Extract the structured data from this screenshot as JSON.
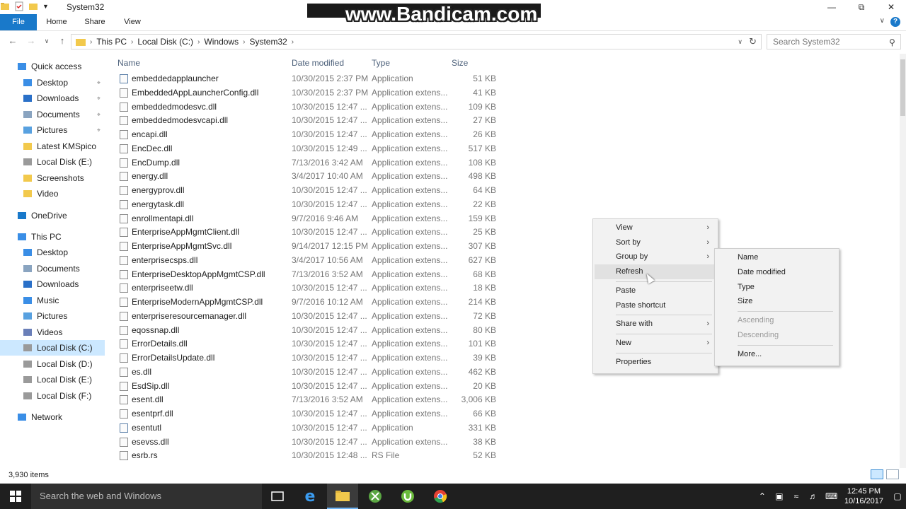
{
  "window": {
    "title": "System32",
    "watermark": "www.Bandicam.com"
  },
  "ribbon": {
    "tabs": [
      "File",
      "Home",
      "Share",
      "View"
    ]
  },
  "address": {
    "crumbs": [
      "This PC",
      "Local Disk (C:)",
      "Windows",
      "System32"
    ],
    "search_placeholder": "Search System32"
  },
  "sidebar": {
    "items": [
      {
        "label": "Quick access",
        "icon": "star-icon",
        "level": 0
      },
      {
        "label": "Desktop",
        "icon": "desktop-icon",
        "level": 1,
        "pinned": true
      },
      {
        "label": "Downloads",
        "icon": "download-icon",
        "level": 1,
        "pinned": true
      },
      {
        "label": "Documents",
        "icon": "documents-icon",
        "level": 1,
        "pinned": true
      },
      {
        "label": "Pictures",
        "icon": "pictures-icon",
        "level": 1,
        "pinned": true
      },
      {
        "label": "Latest KMSpico",
        "icon": "folder-icon",
        "level": 1
      },
      {
        "label": "Local Disk (E:)",
        "icon": "drive-icon",
        "level": 1
      },
      {
        "label": "Screenshots",
        "icon": "folder-icon",
        "level": 1
      },
      {
        "label": "Video",
        "icon": "folder-icon",
        "level": 1
      },
      {
        "label": "OneDrive",
        "icon": "cloud-icon",
        "level": 0
      },
      {
        "label": "This PC",
        "icon": "computer-icon",
        "level": 0
      },
      {
        "label": "Desktop",
        "icon": "desktop-icon",
        "level": 1
      },
      {
        "label": "Documents",
        "icon": "documents-icon",
        "level": 1
      },
      {
        "label": "Downloads",
        "icon": "download-icon",
        "level": 1
      },
      {
        "label": "Music",
        "icon": "music-icon",
        "level": 1
      },
      {
        "label": "Pictures",
        "icon": "pictures-icon",
        "level": 1
      },
      {
        "label": "Videos",
        "icon": "videos-icon",
        "level": 1
      },
      {
        "label": "Local Disk (C:)",
        "icon": "drive-icon",
        "level": 1,
        "selected": true
      },
      {
        "label": "Local Disk  (D:)",
        "icon": "drive-icon",
        "level": 1
      },
      {
        "label": "Local Disk (E:)",
        "icon": "drive-icon",
        "level": 1
      },
      {
        "label": "Local Disk (F:)",
        "icon": "drive-icon",
        "level": 1
      },
      {
        "label": "Network",
        "icon": "network-icon",
        "level": 0
      }
    ]
  },
  "columns": {
    "name": "Name",
    "date": "Date modified",
    "type": "Type",
    "size": "Size"
  },
  "files": [
    {
      "name": "embeddedapplauncher",
      "date": "10/30/2015 2:37 PM",
      "type": "Application",
      "size": "51 KB",
      "app": true
    },
    {
      "name": "EmbeddedAppLauncherConfig.dll",
      "date": "10/30/2015 2:37 PM",
      "type": "Application extens...",
      "size": "41 KB"
    },
    {
      "name": "embeddedmodesvc.dll",
      "date": "10/30/2015 12:47 ...",
      "type": "Application extens...",
      "size": "109 KB"
    },
    {
      "name": "embeddedmodesvcapi.dll",
      "date": "10/30/2015 12:47 ...",
      "type": "Application extens...",
      "size": "27 KB"
    },
    {
      "name": "encapi.dll",
      "date": "10/30/2015 12:47 ...",
      "type": "Application extens...",
      "size": "26 KB"
    },
    {
      "name": "EncDec.dll",
      "date": "10/30/2015 12:49 ...",
      "type": "Application extens...",
      "size": "517 KB"
    },
    {
      "name": "EncDump.dll",
      "date": "7/13/2016 3:42 AM",
      "type": "Application extens...",
      "size": "108 KB"
    },
    {
      "name": "energy.dll",
      "date": "3/4/2017 10:40 AM",
      "type": "Application extens...",
      "size": "498 KB"
    },
    {
      "name": "energyprov.dll",
      "date": "10/30/2015 12:47 ...",
      "type": "Application extens...",
      "size": "64 KB"
    },
    {
      "name": "energytask.dll",
      "date": "10/30/2015 12:47 ...",
      "type": "Application extens...",
      "size": "22 KB"
    },
    {
      "name": "enrollmentapi.dll",
      "date": "9/7/2016 9:46 AM",
      "type": "Application extens...",
      "size": "159 KB"
    },
    {
      "name": "EnterpriseAppMgmtClient.dll",
      "date": "10/30/2015 12:47 ...",
      "type": "Application extens...",
      "size": "25 KB"
    },
    {
      "name": "EnterpriseAppMgmtSvc.dll",
      "date": "9/14/2017 12:15 PM",
      "type": "Application extens...",
      "size": "307 KB"
    },
    {
      "name": "enterprisecsps.dll",
      "date": "3/4/2017 10:56 AM",
      "type": "Application extens...",
      "size": "627 KB"
    },
    {
      "name": "EnterpriseDesktopAppMgmtCSP.dll",
      "date": "7/13/2016 3:52 AM",
      "type": "Application extens...",
      "size": "68 KB"
    },
    {
      "name": "enterpriseetw.dll",
      "date": "10/30/2015 12:47 ...",
      "type": "Application extens...",
      "size": "18 KB"
    },
    {
      "name": "EnterpriseModernAppMgmtCSP.dll",
      "date": "9/7/2016 10:12 AM",
      "type": "Application extens...",
      "size": "214 KB"
    },
    {
      "name": "enterpriseresourcemanager.dll",
      "date": "10/30/2015 12:47 ...",
      "type": "Application extens...",
      "size": "72 KB"
    },
    {
      "name": "eqossnap.dll",
      "date": "10/30/2015 12:47 ...",
      "type": "Application extens...",
      "size": "80 KB"
    },
    {
      "name": "ErrorDetails.dll",
      "date": "10/30/2015 12:47 ...",
      "type": "Application extens...",
      "size": "101 KB"
    },
    {
      "name": "ErrorDetailsUpdate.dll",
      "date": "10/30/2015 12:47 ...",
      "type": "Application extens...",
      "size": "39 KB"
    },
    {
      "name": "es.dll",
      "date": "10/30/2015 12:47 ...",
      "type": "Application extens...",
      "size": "462 KB"
    },
    {
      "name": "EsdSip.dll",
      "date": "10/30/2015 12:47 ...",
      "type": "Application extens...",
      "size": "20 KB"
    },
    {
      "name": "esent.dll",
      "date": "7/13/2016 3:52 AM",
      "type": "Application extens...",
      "size": "3,006 KB"
    },
    {
      "name": "esentprf.dll",
      "date": "10/30/2015 12:47 ...",
      "type": "Application extens...",
      "size": "66 KB"
    },
    {
      "name": "esentutl",
      "date": "10/30/2015 12:47 ...",
      "type": "Application",
      "size": "331 KB",
      "app": true
    },
    {
      "name": "esevss.dll",
      "date": "10/30/2015 12:47 ...",
      "type": "Application extens...",
      "size": "38 KB"
    },
    {
      "name": "esrb.rs",
      "date": "10/30/2015 12:48 ...",
      "type": "RS File",
      "size": "52 KB"
    }
  ],
  "status": {
    "item_count": "3,930 items"
  },
  "context_menu": {
    "items": [
      {
        "label": "View",
        "submenu": true
      },
      {
        "label": "Sort by",
        "submenu": true
      },
      {
        "label": "Group by",
        "submenu": true,
        "highlighted": true
      },
      {
        "label": "Refresh",
        "highlighted": true
      },
      {
        "sep": true
      },
      {
        "label": "Paste"
      },
      {
        "label": "Paste shortcut"
      },
      {
        "sep": true
      },
      {
        "label": "Share with",
        "submenu": true
      },
      {
        "sep": true
      },
      {
        "label": "New",
        "submenu": true
      },
      {
        "sep": true
      },
      {
        "label": "Properties"
      }
    ]
  },
  "submenu": {
    "items": [
      {
        "label": "Name"
      },
      {
        "label": "Date modified"
      },
      {
        "label": "Type"
      },
      {
        "label": "Size"
      },
      {
        "sep": true
      },
      {
        "label": "Ascending",
        "disabled": true
      },
      {
        "label": "Descending",
        "disabled": true
      },
      {
        "sep": true
      },
      {
        "label": "More..."
      }
    ]
  },
  "taskbar": {
    "search_placeholder": "Search the web and Windows",
    "time": "12:45 PM",
    "date": "10/16/2017"
  },
  "colors": {
    "accent": "#1979ca",
    "selected": "#cce8ff",
    "taskbar": "#1f1f1f"
  }
}
